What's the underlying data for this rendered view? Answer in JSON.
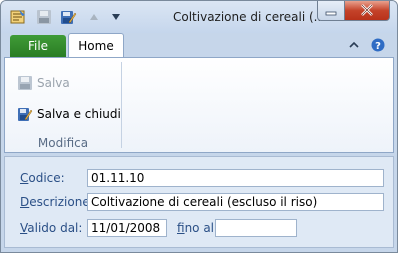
{
  "window": {
    "title": "Coltivazione di cereali (..."
  },
  "quick_access": [
    "app-icon",
    "save-icon",
    "save-close-icon",
    "up-arrow-icon",
    "down-arrow-icon"
  ],
  "tabs": [
    {
      "label": "File"
    },
    {
      "label": "Home"
    }
  ],
  "ribbon": {
    "salva_label": "Salva",
    "salva_chiudi_label": "Salva e chiudi",
    "group_label": "Modifica"
  },
  "form": {
    "codice_label_u": "C",
    "codice_label_rest": "odice:",
    "codice_value": "01.11.10",
    "descrizione_label_u": "D",
    "descrizione_label_rest": "escrizione:",
    "descrizione_value": "Coltivazione di cereali (escluso il riso)",
    "valido_label_u": "V",
    "valido_label_rest": "alido dal:",
    "valido_value": "11/01/2008",
    "fino_label_u": "f",
    "fino_label_rest": "ino al:",
    "fino_value": ""
  },
  "colors": {
    "file_tab": "#2a7d24",
    "label_blue": "#2a4f86",
    "close_red": "#c4432a"
  }
}
